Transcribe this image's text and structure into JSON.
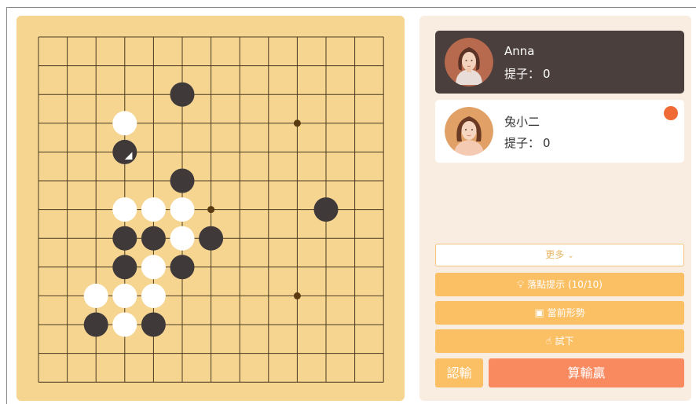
{
  "board": {
    "size": 13,
    "stones": [
      {
        "color": "black",
        "col": 5,
        "row": 2
      },
      {
        "color": "white",
        "col": 3,
        "row": 3
      },
      {
        "color": "black",
        "col": 3,
        "row": 4,
        "last_move": true
      },
      {
        "color": "black",
        "col": 5,
        "row": 5
      },
      {
        "color": "white",
        "col": 3,
        "row": 6
      },
      {
        "color": "white",
        "col": 4,
        "row": 6
      },
      {
        "color": "white",
        "col": 5,
        "row": 6
      },
      {
        "color": "black",
        "col": 10,
        "row": 6
      },
      {
        "color": "black",
        "col": 3,
        "row": 7
      },
      {
        "color": "black",
        "col": 4,
        "row": 7
      },
      {
        "color": "white",
        "col": 5,
        "row": 7
      },
      {
        "color": "black",
        "col": 6,
        "row": 7
      },
      {
        "color": "black",
        "col": 3,
        "row": 8
      },
      {
        "color": "white",
        "col": 4,
        "row": 8
      },
      {
        "color": "black",
        "col": 5,
        "row": 8
      },
      {
        "color": "white",
        "col": 2,
        "row": 9
      },
      {
        "color": "white",
        "col": 3,
        "row": 9
      },
      {
        "color": "white",
        "col": 4,
        "row": 9
      },
      {
        "color": "black",
        "col": 2,
        "row": 10
      },
      {
        "color": "white",
        "col": 3,
        "row": 10
      },
      {
        "color": "black",
        "col": 4,
        "row": 10
      }
    ],
    "star_points": [
      {
        "col": 9,
        "row": 3
      },
      {
        "col": 6,
        "row": 6
      },
      {
        "col": 9,
        "row": 9
      }
    ],
    "colors": {
      "board_bg": "#f5d590",
      "grid_line": "#4a3a20",
      "black_stone": "#3f3939",
      "white_stone": "#ffffff",
      "star_point": "#5a3a10"
    }
  },
  "players": [
    {
      "name": "Anna",
      "capture_label": "提子：",
      "captures": "0",
      "is_turn": false
    },
    {
      "name": "兔小二",
      "capture_label": "提子：",
      "captures": "0",
      "is_turn": true
    }
  ],
  "controls": {
    "more_label": "更多",
    "hint_label": "落點提示 (10/10)",
    "situation_label": "當前形勢",
    "trial_label": "試下",
    "resign_label": "認輸",
    "count_label": "算輸贏"
  },
  "colors": {
    "accent_orange": "#fbbf64",
    "count_button": "#f98a5f",
    "turn_indicator": "#f06a35",
    "dark_card": "#4a3f3c",
    "panel_bg": "#f8ede0"
  }
}
